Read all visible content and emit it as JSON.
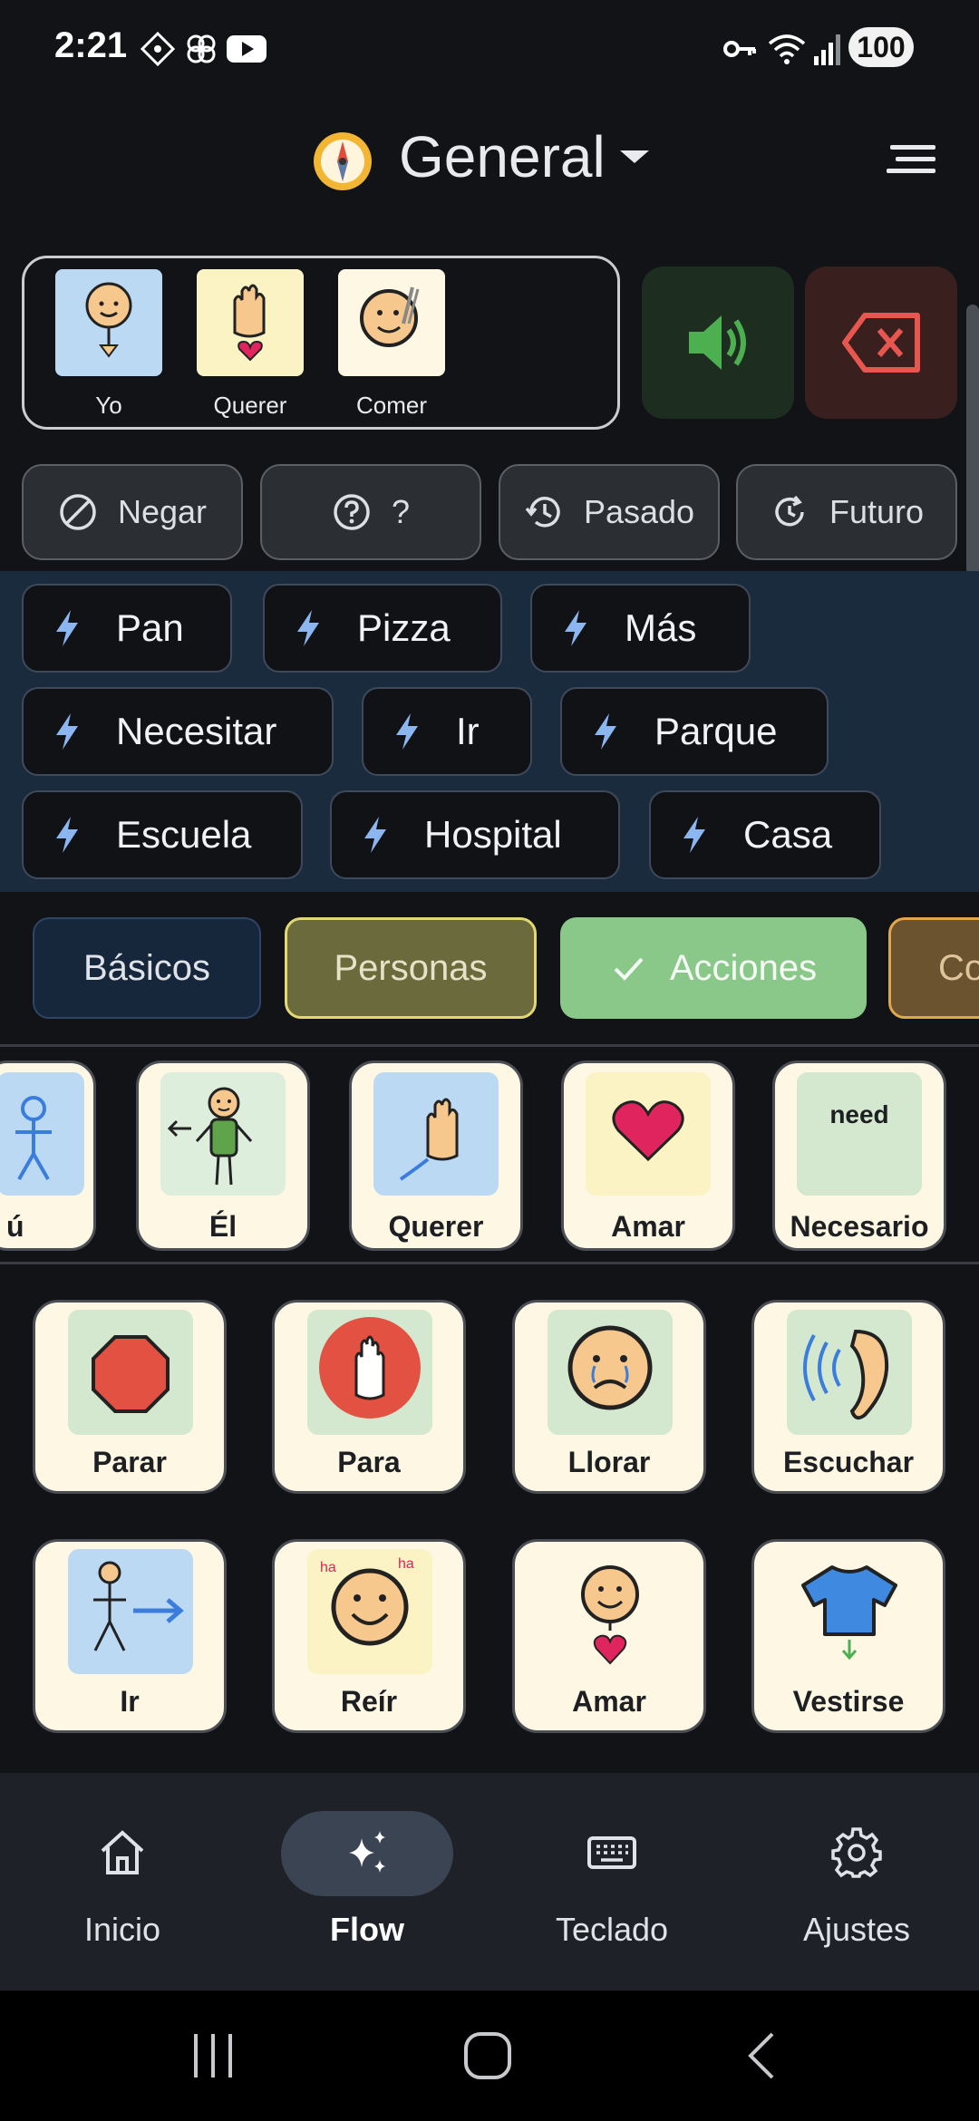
{
  "status_bar": {
    "time": "2:21",
    "battery": "100"
  },
  "header": {
    "title": "General"
  },
  "sentence": [
    {
      "label": "Yo"
    },
    {
      "label": "Querer"
    },
    {
      "label": "Comer"
    }
  ],
  "modifiers": [
    {
      "label": "Negar",
      "icon": "block-icon"
    },
    {
      "label": "?",
      "icon": "help-circle-icon"
    },
    {
      "label": "Pasado",
      "icon": "history-icon"
    },
    {
      "label": "Futuro",
      "icon": "refresh-icon"
    }
  ],
  "quick_words": [
    "Pan",
    "Pizza",
    "Más",
    "Necesitar",
    "Ir",
    "Parque",
    "Escuela",
    "Hospital",
    "Casa"
  ],
  "categories": [
    {
      "label": "Básicos",
      "color": "#16263b"
    },
    {
      "label": "Personas",
      "color": "#6b6a3c"
    },
    {
      "label": "Acciones",
      "color": "#8ac889",
      "selected": true
    },
    {
      "label": "Co",
      "color": "#6b5330"
    }
  ],
  "row_cards": [
    {
      "label": "ú"
    },
    {
      "label": "Él"
    },
    {
      "label": "Querer"
    },
    {
      "label": "Amar"
    },
    {
      "label": "Necesario",
      "pic_text": "need"
    }
  ],
  "grid_cards": [
    {
      "label": "Parar"
    },
    {
      "label": "Para"
    },
    {
      "label": "Llorar"
    },
    {
      "label": "Escuchar"
    },
    {
      "label": "Ir"
    },
    {
      "label": "Reír",
      "pic_text_left": "ha",
      "pic_text_right": "ha"
    },
    {
      "label": "Amar"
    },
    {
      "label": "Vestirse"
    }
  ],
  "nav": [
    {
      "label": "Inicio",
      "icon": "home-icon"
    },
    {
      "label": "Flow",
      "icon": "sparkles-icon",
      "active": true
    },
    {
      "label": "Teclado",
      "icon": "keyboard-icon"
    },
    {
      "label": "Ajustes",
      "icon": "gear-icon"
    }
  ],
  "colors": {
    "background": "#111317",
    "quick_band": "#1b2b3e",
    "card": "#fdf7e4",
    "accent_green": "#8ac889",
    "speak_green": "#4caf50",
    "delete_red": "#e8574f"
  }
}
